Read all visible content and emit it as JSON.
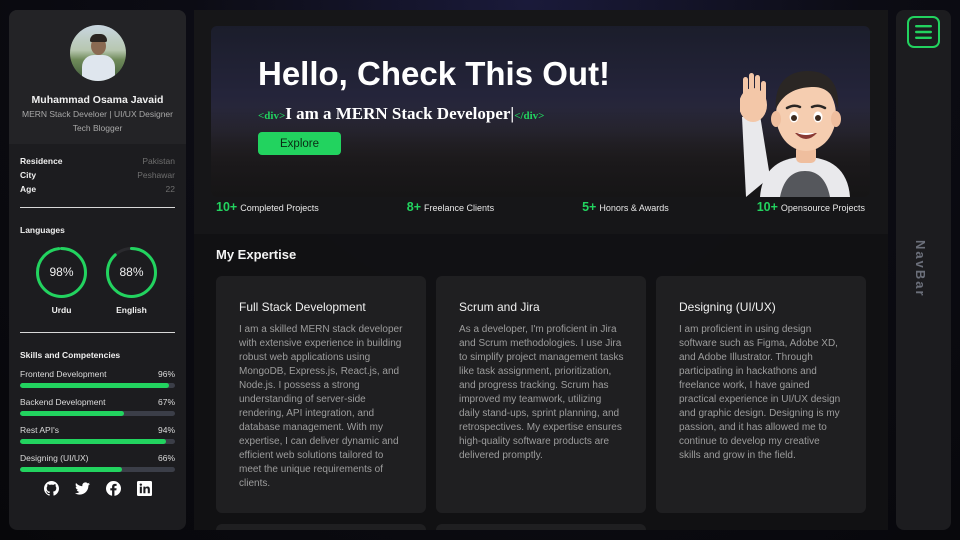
{
  "profile": {
    "name": "Muhammad Osama Javaid",
    "role_line1": "MERN Stack Develoer | UI/UX Designer",
    "role_line2": "Tech Blogger"
  },
  "info": [
    {
      "key": "Residence",
      "value": "Pakistan"
    },
    {
      "key": "City",
      "value": "Peshawar"
    },
    {
      "key": "Age",
      "value": "22"
    }
  ],
  "languages": {
    "title": "Languages",
    "items": [
      {
        "name": "Urdu",
        "percent_label": "98%",
        "percent": 98
      },
      {
        "name": "English",
        "percent_label": "88%",
        "percent": 88
      }
    ]
  },
  "skills": {
    "title": "Skills and Competencies",
    "items": [
      {
        "name": "Frontend Development",
        "percent_label": "96%",
        "percent": 96
      },
      {
        "name": "Backend Development",
        "percent_label": "67%",
        "percent": 67
      },
      {
        "name": "Rest API's",
        "percent_label": "94%",
        "percent": 94
      },
      {
        "name": "Designing (UI/UX)",
        "percent_label": "66%",
        "percent": 66
      }
    ]
  },
  "socials": [
    "github-icon",
    "twitter-icon",
    "facebook-icon",
    "linkedin-icon"
  ],
  "hero": {
    "title": "Hello, Check This Out!",
    "tag_open": "<div>",
    "subtitle": "I am a MERN Stack Developer|",
    "tag_close": "</div>",
    "button": "Explore"
  },
  "stats": [
    {
      "num": "10+",
      "label": "Completed Projects"
    },
    {
      "num": "8+",
      "label": "Freelance Clients"
    },
    {
      "num": "5+",
      "label": "Honors & Awards"
    },
    {
      "num": "10+",
      "label": "Opensource Projects"
    }
  ],
  "expertise": {
    "title": "My Expertise",
    "cards": [
      {
        "title": "Full Stack Development",
        "text": "I am a skilled MERN stack developer with extensive experience in building robust web applications using MongoDB, Express.js, React.js, and Node.js. I possess a strong understanding of server-side rendering, API integration, and database management. With my expertise, I can deliver dynamic and efficient web solutions tailored to meet the unique requirements of clients."
      },
      {
        "title": "Scrum and Jira",
        "text": "As a developer, I'm proficient in Jira and Scrum methodologies. I use Jira to simplify project management tasks like task assignment, prioritization, and progress tracking. Scrum has improved my teamwork, utilizing daily stand-ups, sprint planning, and retrospectives. My expertise ensures high-quality software products are delivered promptly."
      },
      {
        "title": "Designing (UI/UX)",
        "text": "I am proficient in using design software such as Figma, Adobe XD, and Adobe Illustrator. Through participating in hackathons and freelance work, I have gained practical experience in UI/UX design and graphic design. Designing is my passion, and it has allowed me to continue to develop my creative skills and grow in the field."
      }
    ]
  },
  "navbar": {
    "label": "NavBar"
  },
  "colors": {
    "accent": "#22d35f",
    "panel": "#1c1c1f",
    "card": "#1f1f21"
  }
}
